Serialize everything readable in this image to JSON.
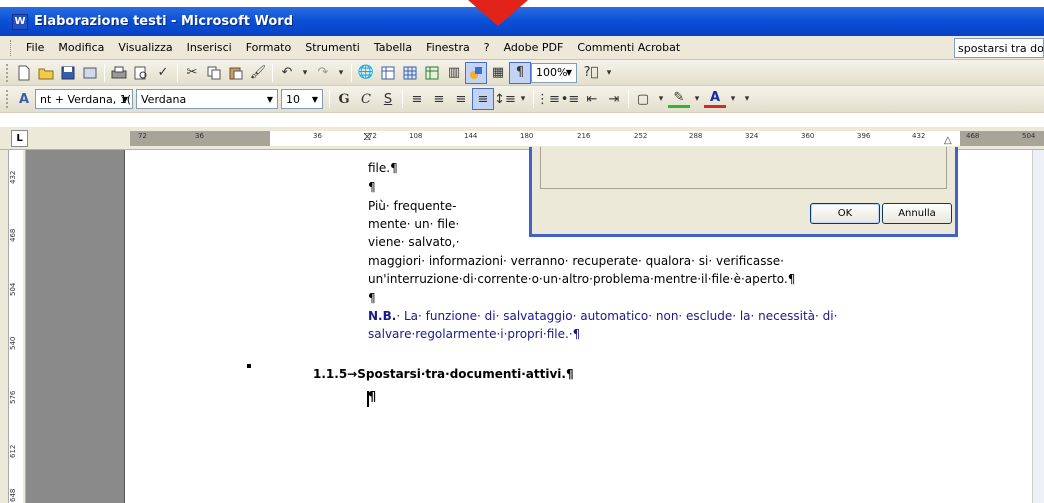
{
  "window": {
    "title": "Elaborazione testi - Microsoft Word",
    "accent": "#0a4fd6"
  },
  "menu": {
    "items": [
      "File",
      "Modifica",
      "Visualizza",
      "Inserisci",
      "Formato",
      "Strumenti",
      "Tabella",
      "Finestra",
      "?",
      "Adobe PDF",
      "Commenti Acrobat"
    ],
    "help_search": "spostarsi tra do"
  },
  "toolbar": {
    "zoom": "100%",
    "style": "nt + Verdana, 1(",
    "font": "Verdana",
    "size": "10"
  },
  "ruler": {
    "corner": "L",
    "ticks": [
      "72",
      "36",
      "36",
      "72",
      "108",
      "144",
      "180",
      "216",
      "252",
      "288",
      "324",
      "360",
      "396",
      "432",
      "468",
      "504"
    ],
    "vticks": [
      "432",
      "468",
      "504",
      "540",
      "576",
      "612",
      "648"
    ]
  },
  "document": {
    "line_file": "file.¶",
    "line_pilcrow1": "¶",
    "line_piu": "Più·      frequente-",
    "line_mente": "mente·   un·   file·",
    "line_viene": "viene·      salvato,·",
    "line_maggiori": "maggiori·  informazioni·  verranno·  recuperate·  qualora·  si·  verificasse·",
    "line_interruzione": "un'interruzione·di·corrente·o·un·altro·problema·mentre·il·file·è·aperto.¶",
    "line_pilcrow2": "¶",
    "nb_label": "N.B.",
    "nb_line1": "· La· funzione· di· salvataggio· automatico· non· esclude· la· necessità· di·",
    "nb_line2": "salvare·regolarmente·i·propri·file.·¶",
    "heading": "1.1.5→Spostarsi·tra·documenti·attivi.¶",
    "cursor_mark": "¶"
  },
  "dialog": {
    "ok_label": "OK",
    "cancel_label": "Annulla"
  }
}
